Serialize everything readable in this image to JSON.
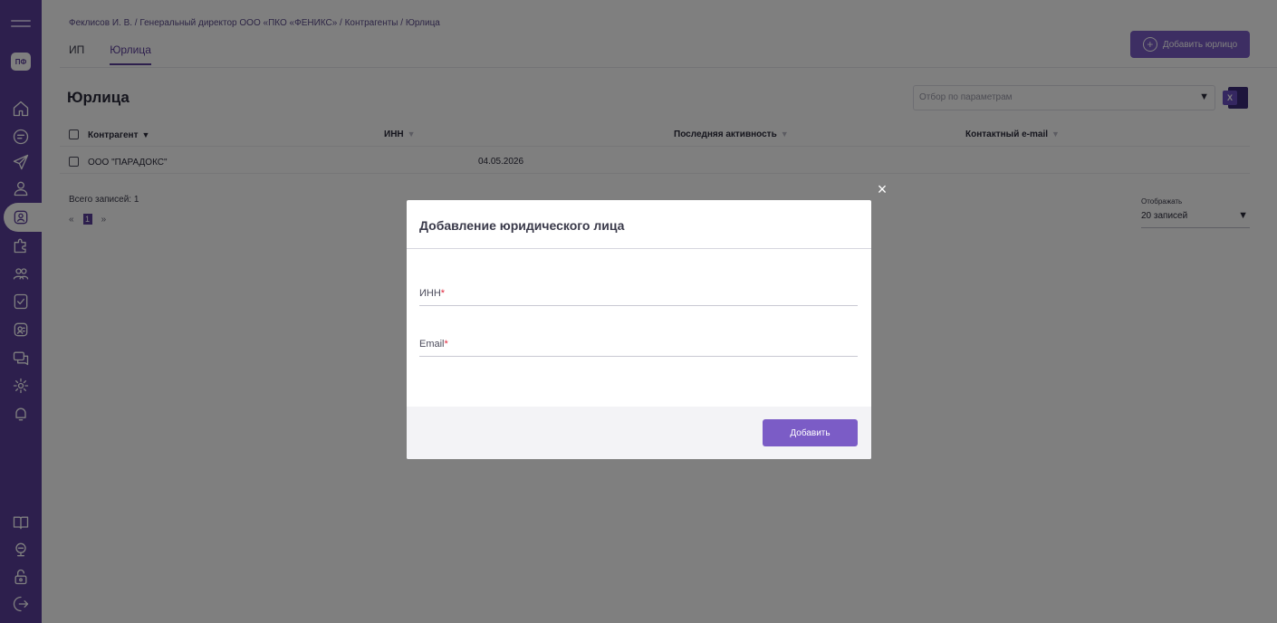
{
  "sidebar": {
    "logo": "ПФ",
    "icons_top": [
      "home-icon",
      "document-icon",
      "send-icon",
      "user-icon",
      "contractor-icon",
      "puzzle-icon",
      "group-icon",
      "report-icon",
      "badge-icon",
      "chat-icon",
      "settings-icon",
      "bell-icon"
    ],
    "icons_bottom": [
      "book-icon",
      "support-icon",
      "lock-icon",
      "logout-icon"
    ]
  },
  "header": {
    "breadcrumb": "Феклисов И. В.  /  Генеральный директор ООО «ПКО «ФЕНИКС»  /  Контрагенты  /  Юрлица",
    "tabs": [
      {
        "label": "ИП",
        "active": false
      },
      {
        "label": "Юрлица",
        "active": true
      }
    ],
    "add_button_label": "Добавить юрлицо"
  },
  "main": {
    "title": "Юрлица",
    "filter_placeholder": "Отбор по параметрам",
    "excel_label": "X",
    "columns": [
      {
        "label": "Контрагент",
        "sort": "▼"
      },
      {
        "label": "ИНН",
        "sort": "▼"
      },
      {
        "label": "Последняя активность",
        "sort": "▼"
      },
      {
        "label": "Контактный e-mail",
        "sort": "▼"
      }
    ],
    "rows": [
      {
        "name": "ООО \"ПАРАДОКС\"",
        "inn": "",
        "activity": "04.05.2026",
        "email": ""
      }
    ],
    "total": "Всего записей: 1",
    "pager": {
      "prev": "«",
      "current": "1",
      "next": "»"
    },
    "per_page_label": "Отображать",
    "per_page_value": "20 записей"
  },
  "modal": {
    "close": "×",
    "title": "Добавление юридического лица",
    "fields": [
      {
        "label": "ИНН",
        "required": "*"
      },
      {
        "label": "Email",
        "required": "*"
      }
    ],
    "submit_label": "Добавить"
  },
  "colors": {
    "brand": "#5b3e9a",
    "accent": "#7b5cc6",
    "required": "#e0263c"
  }
}
